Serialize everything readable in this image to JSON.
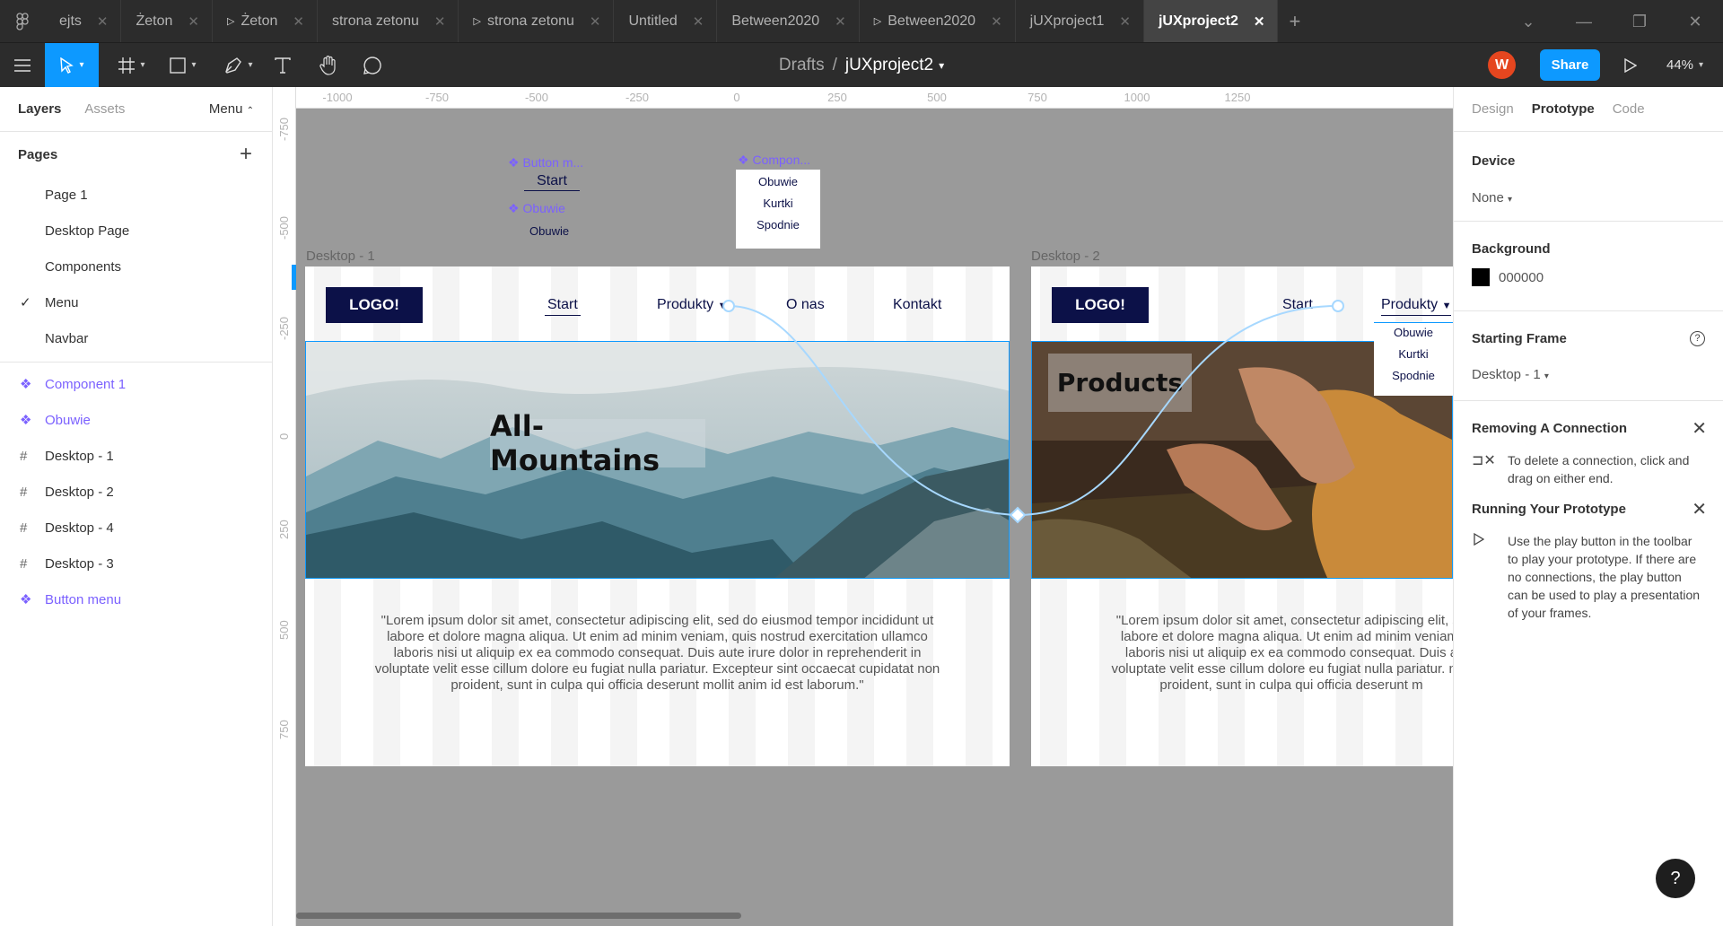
{
  "tabs": [
    {
      "label": "ejts",
      "play": false,
      "active": false
    },
    {
      "label": "Żeton",
      "play": false,
      "active": false
    },
    {
      "label": "Żeton",
      "play": true,
      "active": false
    },
    {
      "label": "strona zetonu",
      "play": false,
      "active": false
    },
    {
      "label": "strona zetonu",
      "play": true,
      "active": false
    },
    {
      "label": "Untitled",
      "play": false,
      "active": false
    },
    {
      "label": "Between2020",
      "play": false,
      "active": false
    },
    {
      "label": "Between2020",
      "play": true,
      "active": false
    },
    {
      "label": "jUXproject1",
      "play": false,
      "active": false
    },
    {
      "label": "jUXproject2",
      "play": false,
      "active": true
    }
  ],
  "toolbar": {
    "breadcrumb_parent": "Drafts",
    "breadcrumb_sep": "/",
    "file_name": "jUXproject2",
    "avatar_initial": "W",
    "share_label": "Share",
    "zoom": "44%"
  },
  "left_panel": {
    "tab_layers": "Layers",
    "tab_assets": "Assets",
    "page_menu": "Menu",
    "pages_title": "Pages",
    "pages": [
      "Page 1",
      "Desktop Page",
      "Components",
      "Menu",
      "Navbar"
    ],
    "current_page": "Menu",
    "layers": [
      {
        "name": "Component 1",
        "type": "component"
      },
      {
        "name": "Obuwie",
        "type": "component"
      },
      {
        "name": "Desktop - 1",
        "type": "frame"
      },
      {
        "name": "Desktop - 2",
        "type": "frame"
      },
      {
        "name": "Desktop - 4",
        "type": "frame"
      },
      {
        "name": "Desktop - 3",
        "type": "frame"
      },
      {
        "name": "Button menu",
        "type": "component"
      }
    ]
  },
  "ruler": {
    "top": [
      "-1000",
      "-750",
      "-500",
      "-250",
      "0",
      "250",
      "500",
      "750",
      "1000",
      "1250"
    ],
    "left": [
      "-750",
      "-500",
      "-250",
      "0",
      "250",
      "500",
      "750"
    ]
  },
  "canvas": {
    "button_menu_label": "Button m...",
    "button_menu_text": "Start",
    "obuwie_label": "Obuwie",
    "obuwie_text": "Obuwie",
    "component_label": "Compon...",
    "dropdown_items": [
      "Obuwie",
      "Kurtki",
      "Spodnie"
    ],
    "frame1": {
      "title": "Desktop - 1",
      "logo": "LOGO!",
      "nav": [
        "Start",
        "Produkty",
        "O nas",
        "Kontakt"
      ],
      "hero_title": "All-Mountains",
      "lorem": "\"Lorem ipsum dolor sit amet, consectetur adipiscing elit, sed do eiusmod tempor incididunt ut labore et dolore magna aliqua. Ut enim ad minim veniam, quis nostrud exercitation ullamco laboris nisi ut aliquip ex ea commodo consequat. Duis aute irure dolor in reprehenderit in voluptate velit esse cillum dolore eu fugiat nulla pariatur. Excepteur sint occaecat cupidatat non proident, sunt in culpa qui officia deserunt mollit anim id est laborum.\""
    },
    "frame2": {
      "title": "Desktop - 2",
      "logo": "LOGO!",
      "nav": [
        "Start",
        "Produkty"
      ],
      "dropdown": [
        "Obuwie",
        "Kurtki",
        "Spodnie"
      ],
      "hero_title": "Products",
      "lorem": "\"Lorem ipsum dolor sit amet, consectetur adipiscing elit, se labore et dolore magna aliqua. Ut enim ad minim veniam, laboris nisi ut aliquip ex ea commodo consequat. Duis a voluptate velit esse cillum dolore eu fugiat nulla pariatur. non proident, sunt in culpa qui officia deserunt m"
    }
  },
  "right_panel": {
    "tabs": [
      "Design",
      "Prototype",
      "Code"
    ],
    "active_tab": "Prototype",
    "device_title": "Device",
    "device_value": "None",
    "background_title": "Background",
    "background_hex": "000000",
    "starting_frame_title": "Starting Frame",
    "starting_frame_value": "Desktop - 1",
    "removing_title": "Removing A Connection",
    "removing_text": "To delete a connection, click and drag on either end.",
    "running_title": "Running Your Prototype",
    "running_text": "Use the play button in the toolbar to play your prototype. If there are no connections, the play button can be used to play a presentation of your frames."
  },
  "colors": {
    "accent": "#0d99ff",
    "component": "#7b61ff",
    "navy": "#0c1148",
    "avatar": "#e5461f"
  },
  "help_label": "?"
}
